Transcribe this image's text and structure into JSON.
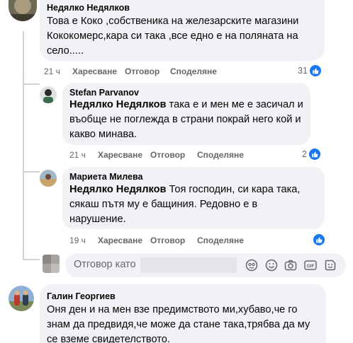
{
  "comments": [
    {
      "author": "Недялко Недялков",
      "text": "Това е Коко ,собственика на железарските магазини Кококомерс,кара си така ,все едно е на поляната на село.....",
      "time": "21 ч",
      "like_label": "Харесване",
      "reply_label": "Отговор",
      "share_label": "Споделяне",
      "reaction_count": "31"
    },
    {
      "author": "Stefan Parvanov",
      "mention": "Недялко Недялков",
      "text": " така е и мен ме е засичал и въобще не поглежда в страни покрай него кой и какво минава.",
      "time": "21 ч",
      "like_label": "Харесване",
      "reply_label": "Отговор",
      "share_label": "Споделяне",
      "reaction_count": "2"
    },
    {
      "author": "Мариета Милева",
      "mention": "Недялко Недялков",
      "text": " Тоя господин, си кара така, сякаш пътя му е бащиния. Редовно е в нарушение.",
      "time": "19 ч",
      "like_label": "Харесване",
      "reply_label": "Отговор",
      "share_label": "Споделяне"
    },
    {
      "author": "Галин Георгиев",
      "text": "Оня ден и на мен взе предимството ми,хубаво,че го знам да предвидя,че може да стане така,трябва да му се вземе свидетелството."
    }
  ],
  "reply_box": {
    "placeholder": "Отговор като"
  },
  "icons": {
    "like_badge": "thumbs-up-icon",
    "avatar_sticker": "avatar-sticker-icon",
    "emoji": "emoji-icon",
    "camera": "camera-icon",
    "gif": "gif-icon",
    "sticker": "sticker-icon"
  },
  "colors": {
    "accent": "#1877f2",
    "bubble": "#f0f2f5",
    "secondary_text": "#65676b"
  }
}
